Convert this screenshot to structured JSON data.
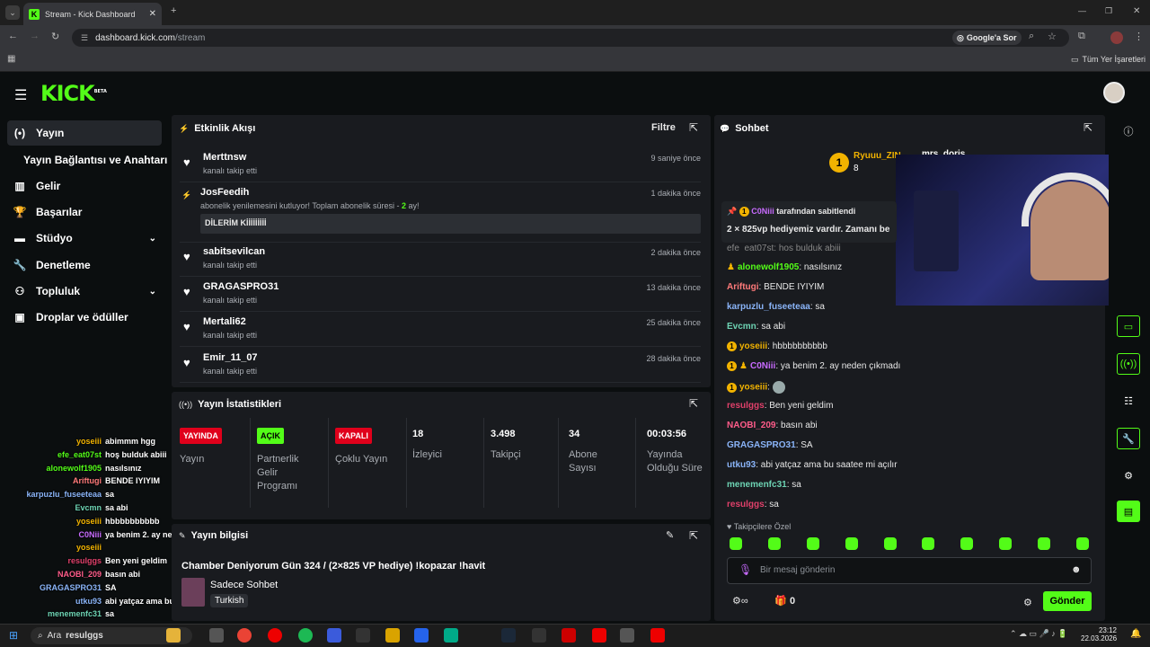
{
  "browser": {
    "tab_title": "Stream - Kick Dashboard",
    "url_host": "dashboard.kick.com",
    "url_path": "/stream",
    "google_lens": "Google'a Sor",
    "bookmarks_label": "Tüm Yer İşaretleri"
  },
  "header": {
    "logo": "KICK",
    "logo_beta": "BETA"
  },
  "sidebar": {
    "items": [
      {
        "label": "Yayın",
        "icon": "broadcast-icon"
      },
      {
        "label": "Yayın Bağlantısı ve Anahtarı",
        "icon": ""
      },
      {
        "label": "Gelir",
        "icon": "chart-icon"
      },
      {
        "label": "Başarılar",
        "icon": "trophy-icon"
      },
      {
        "label": "Stüdyo",
        "icon": "studio-icon"
      },
      {
        "label": "Denetleme",
        "icon": "wrench-icon"
      },
      {
        "label": "Topluluk",
        "icon": "community-icon"
      },
      {
        "label": "Droplar ve ödüller",
        "icon": "gift-icon"
      }
    ]
  },
  "activity": {
    "title": "Etkinlik Akışı",
    "filter": "Filtre",
    "items": [
      {
        "name": "Merttnsw",
        "sub": "kanalı takip etti",
        "time": "9 saniye önce"
      },
      {
        "name": "JosFeedih",
        "sub": "abonelik yenilemesini kutluyor! Toplam abonelik süresi - ",
        "sub_count": "2",
        "sub_unit": " ay!",
        "message": "DİLERİM Kİİİİİİİİİ",
        "time": "1 dakika önce"
      },
      {
        "name": "sabitsevilcan",
        "sub": "kanalı takip etti",
        "time": "2 dakika önce"
      },
      {
        "name": "GRAGASPRO31",
        "sub": "kanalı takip etti",
        "time": "13 dakika önce"
      },
      {
        "name": "Mertali62",
        "sub": "kanalı takip etti",
        "time": "25 dakika önce"
      },
      {
        "name": "Emir_11_07",
        "sub": "kanalı takip etti",
        "time": "28 dakika önce"
      }
    ]
  },
  "stats": {
    "title": "Yayın İstatistikleri",
    "cards": [
      {
        "badge": "YAYINDA",
        "label": "Yayın",
        "color": "#e0001b",
        "text": "#ffffff"
      },
      {
        "badge": "AÇIK",
        "label": "Partnerlik Gelir Programı",
        "color": "#53fc18",
        "text": "#000000"
      },
      {
        "badge": "KAPALI",
        "label": "Çoklu Yayın",
        "color": "#e0001b",
        "text": "#ffffff"
      }
    ],
    "values": [
      {
        "value": "18",
        "label": "İzleyici"
      },
      {
        "value": "3.498",
        "label": "Takipçi"
      },
      {
        "value": "34",
        "label": "Abone Sayısı"
      },
      {
        "value": "00:03:56",
        "label": "Yayında Olduğu Süre"
      }
    ]
  },
  "info": {
    "title": "Yayın bilgisi",
    "stream_title": "Chamber Deniyorum Gün 324 / (2×825 VP hediye) !kopazar !havit",
    "category": "Sadece Sohbet",
    "language": "Turkish"
  },
  "chat": {
    "title": "Sohbet",
    "top_user": "Ryuuu_ZIN",
    "top_count": "8",
    "second_user": "mrs_doris",
    "second_count": "6",
    "pinned_by": "C0Niii",
    "pinned_suffix": "tarafından sabitlendi",
    "pinned_text": "2 × 825vp hediyemiz vardır. Zamanı be",
    "partial_line": "efe_eat07st: hoş bulduk abiii",
    "lines": [
      {
        "user": "alonewolf1905",
        "text": "nasılsınız",
        "color": "#53fc18"
      },
      {
        "user": "Ariftugi",
        "text": "BENDE IYIYIM",
        "color": "#ff7a7a"
      },
      {
        "user": "karpuzlu_fuseeteaa",
        "text": "sa",
        "color": "#8ab4f8"
      },
      {
        "user": "Evcmn",
        "text": "sa abi",
        "color": "#6dd3b3"
      },
      {
        "user": "yoseiii",
        "text": "hbbbbbbbbbb",
        "color": "#f2b300"
      },
      {
        "user": "C0Niii",
        "text": "ya benim 2. ay neden çıkmadı",
        "color": "#c86bff"
      },
      {
        "user": "yoseiii",
        "text": "",
        "color": "#f2b300"
      },
      {
        "user": "resulggs",
        "text": "Ben yeni geldim",
        "color": "#e0406a"
      },
      {
        "user": "NAOBI_209",
        "text": "basın abi",
        "color": "#ff5c8a"
      },
      {
        "user": "GRAGASPRO31",
        "text": "SA",
        "color": "#8ab4f8"
      },
      {
        "user": "utku93",
        "text": "abi yatçaz ama bu saatee mi açılır",
        "color": "#8ab4f8"
      },
      {
        "user": "menemenfc31",
        "text": "sa",
        "color": "#6dd3b3"
      },
      {
        "user": "resulggs",
        "text": "sa",
        "color": "#e0406a"
      }
    ],
    "followers_only": "Takipçilere Özel",
    "placeholder": "Bir mesaj gönderin",
    "count": "0",
    "send": "Gönder"
  },
  "overlay": {
    "lines": [
      {
        "user": "yoseiii",
        "text": "abimmm hgg",
        "color": "#f2b300"
      },
      {
        "user": "efe_eat07st",
        "text": "hoş bulduk abiii",
        "color": "#53fc18"
      },
      {
        "user": "alonewolf1905",
        "text": "nasılsınız",
        "color": "#53fc18"
      },
      {
        "user": "Ariftugi",
        "text": "BENDE IYIYIM",
        "color": "#ff7a7a"
      },
      {
        "user": "karpuzlu_fuseeteaa",
        "text": "sa",
        "color": "#8ab4f8"
      },
      {
        "user": "Evcmn",
        "text": "sa abi",
        "color": "#6dd3b3"
      },
      {
        "user": "yoseiii",
        "text": "hbbbbbbbbbb",
        "color": "#f2b300"
      },
      {
        "user": "C0Niii",
        "text": "ya benim 2. ay neden çıkmadı",
        "color": "#c86bff"
      },
      {
        "user": "yoseiii",
        "text": "",
        "color": "#f2b300"
      },
      {
        "user": "resulggs",
        "text": "Ben yeni geldim",
        "color": "#e0406a"
      },
      {
        "user": "NAOBI_209",
        "text": "basın abi",
        "color": "#ff5c8a"
      },
      {
        "user": "GRAGASPRO31",
        "text": "SA",
        "color": "#8ab4f8"
      },
      {
        "user": "utku93",
        "text": "abi yatçaz ama bu saatee mi açılır",
        "color": "#8ab4f8"
      },
      {
        "user": "menemenfc31",
        "text": "sa",
        "color": "#6dd3b3"
      }
    ]
  },
  "taskbar": {
    "search": "Ara",
    "search_term": "resulggs",
    "time": "23:12",
    "date": "22.03.2026"
  },
  "colors": {
    "accent": "#53fc18",
    "panel": "#191b1f",
    "bg": "#0b0e0f"
  }
}
